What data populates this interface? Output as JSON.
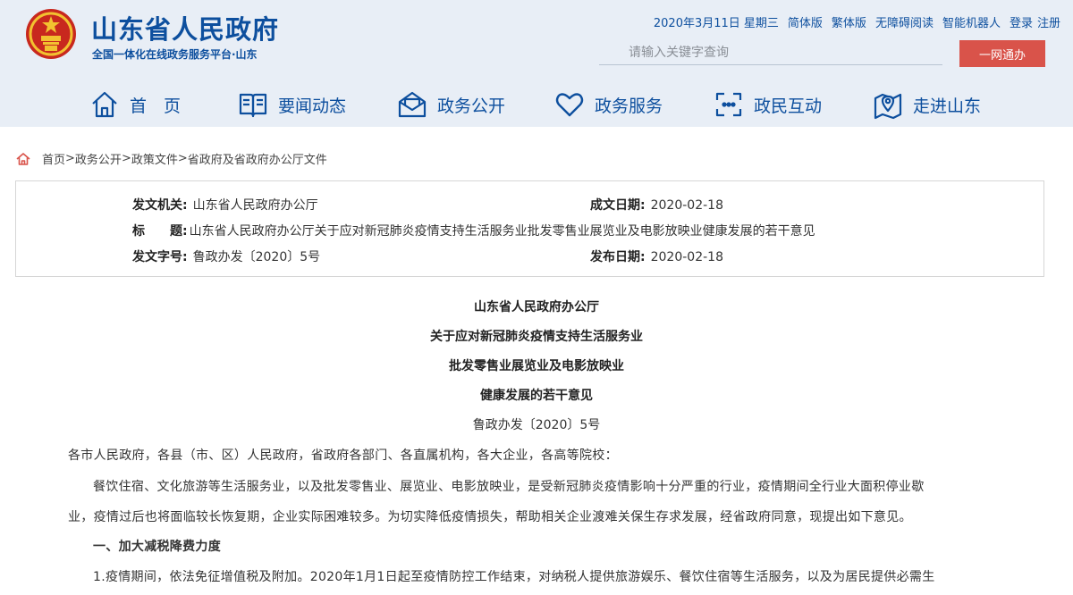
{
  "header": {
    "site_title": "山东省人民政府",
    "site_subtitle": "全国一体化在线政务服务平台·山东",
    "date": "2020年3月11日 星期三",
    "links": [
      "简体版",
      "繁体版",
      "无障碍阅读",
      "智能机器人",
      "登录",
      "注册"
    ],
    "search_placeholder": "请输入关键字查询",
    "yiwang_label": "一网通办"
  },
  "nav": [
    {
      "label": "首　页",
      "icon": "home-icon"
    },
    {
      "label": "要闻动态",
      "icon": "book-icon"
    },
    {
      "label": "政务公开",
      "icon": "mail-icon"
    },
    {
      "label": "政务服务",
      "icon": "heart-icon"
    },
    {
      "label": "政民互动",
      "icon": "chat-icon"
    },
    {
      "label": "走进山东",
      "icon": "location-icon"
    }
  ],
  "breadcrumb": [
    "首页",
    "政务公开",
    "政策文件",
    "省政府及省政府办公厅文件"
  ],
  "meta": {
    "issuer_label": "发文机关:",
    "issuer": "山东省人民政府办公厅",
    "created_label": "成文日期:",
    "created": "2020-02-18",
    "title_label": "标　　题:",
    "title": "山东省人民政府办公厅关于应对新冠肺炎疫情支持生活服务业批发零售业展览业及电影放映业健康发展的若干意见",
    "docno_label": "发文字号:",
    "docno": "鲁政办发〔2020〕5号",
    "published_label": "发布日期:",
    "published": "2020-02-18"
  },
  "article": {
    "heading_lines": [
      "山东省人民政府办公厅",
      "关于应对新冠肺炎疫情支持生活服务业",
      "批发零售业展览业及电影放映业",
      "健康发展的若干意见"
    ],
    "doc_number": "鲁政办发〔2020〕5号",
    "addressee": "各市人民政府，各县（市、区）人民政府，省政府各部门、各直属机构，各大企业，各高等院校：",
    "para1_line1": "餐饮住宿、文化旅游等生活服务业，以及批发零售业、展览业、电影放映业，是受新冠肺炎疫情影响十分严重的行业，疫情期间全行业大面积停业歇",
    "para1_line2": "业，疫情过后也将面临较长恢复期，企业实际困难较多。为切实降低疫情损失，帮助相关企业渡难关保生存求发展，经省政府同意，现提出如下意见。",
    "section1": "一、加大减税降费力度",
    "item1": "1.疫情期间，依法免征增值税及附加。2020年1月1日起至疫情防控工作结束，对纳税人提供旅游娱乐、餐饮住宿等生活服务，以及为居民提供必需生"
  },
  "colors": {
    "brand_blue": "#0d4f9e",
    "header_bg": "#e8eef6",
    "button_red": "#d9534a"
  }
}
